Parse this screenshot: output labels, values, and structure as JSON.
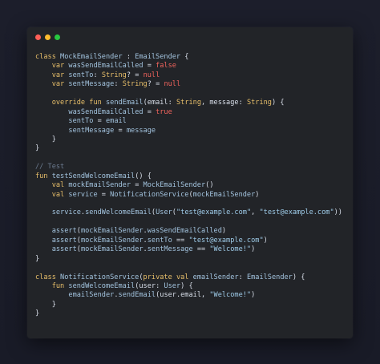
{
  "window": {
    "controls": [
      {
        "name": "close",
        "color": "#ff5f57"
      },
      {
        "name": "minimize",
        "color": "#febc2e"
      },
      {
        "name": "zoom",
        "color": "#28c840"
      }
    ]
  },
  "code_lines": [
    [
      {
        "text": "class ",
        "cls": "k"
      },
      {
        "text": "MockEmailSender",
        "cls": "c"
      },
      {
        "text": " : ",
        "cls": "p"
      },
      {
        "text": "EmailSender",
        "cls": "c"
      },
      {
        "text": " {",
        "cls": "p"
      }
    ],
    [
      {
        "text": "    ",
        "cls": "p"
      },
      {
        "text": "var ",
        "cls": "k"
      },
      {
        "text": "wasSendEmailCalled",
        "cls": "c"
      },
      {
        "text": " = ",
        "cls": "p"
      },
      {
        "text": "false",
        "cls": "b"
      }
    ],
    [
      {
        "text": "    ",
        "cls": "p"
      },
      {
        "text": "var ",
        "cls": "k"
      },
      {
        "text": "sentTo",
        "cls": "c"
      },
      {
        "text": ": ",
        "cls": "p"
      },
      {
        "text": "String",
        "cls": "k"
      },
      {
        "text": "? = ",
        "cls": "p"
      },
      {
        "text": "null",
        "cls": "b"
      }
    ],
    [
      {
        "text": "    ",
        "cls": "p"
      },
      {
        "text": "var ",
        "cls": "k"
      },
      {
        "text": "sentMessage",
        "cls": "c"
      },
      {
        "text": ": ",
        "cls": "p"
      },
      {
        "text": "String",
        "cls": "k"
      },
      {
        "text": "? = ",
        "cls": "p"
      },
      {
        "text": "null",
        "cls": "b"
      }
    ],
    [],
    [
      {
        "text": "    ",
        "cls": "p"
      },
      {
        "text": "override ",
        "cls": "k"
      },
      {
        "text": "fun ",
        "cls": "k"
      },
      {
        "text": "sendEmail",
        "cls": "c"
      },
      {
        "text": "(email: ",
        "cls": "p"
      },
      {
        "text": "String",
        "cls": "k"
      },
      {
        "text": ", message: ",
        "cls": "p"
      },
      {
        "text": "String",
        "cls": "k"
      },
      {
        "text": ") {",
        "cls": "p"
      }
    ],
    [
      {
        "text": "        ",
        "cls": "p"
      },
      {
        "text": "wasSendEmailCalled",
        "cls": "c"
      },
      {
        "text": " = ",
        "cls": "p"
      },
      {
        "text": "true",
        "cls": "b"
      }
    ],
    [
      {
        "text": "        ",
        "cls": "p"
      },
      {
        "text": "sentTo",
        "cls": "c"
      },
      {
        "text": " = ",
        "cls": "p"
      },
      {
        "text": "email",
        "cls": "c"
      }
    ],
    [
      {
        "text": "        ",
        "cls": "p"
      },
      {
        "text": "sentMessage",
        "cls": "c"
      },
      {
        "text": " = ",
        "cls": "p"
      },
      {
        "text": "message",
        "cls": "c"
      }
    ],
    [
      {
        "text": "    }",
        "cls": "p"
      }
    ],
    [
      {
        "text": "}",
        "cls": "p"
      }
    ],
    [],
    [
      {
        "text": "// Test",
        "cls": "cm"
      }
    ],
    [
      {
        "text": "fun ",
        "cls": "k"
      },
      {
        "text": "testSendWelcomeEmail",
        "cls": "c"
      },
      {
        "text": "() {",
        "cls": "p"
      }
    ],
    [
      {
        "text": "    ",
        "cls": "p"
      },
      {
        "text": "val ",
        "cls": "k"
      },
      {
        "text": "mockEmailSender",
        "cls": "c"
      },
      {
        "text": " = ",
        "cls": "p"
      },
      {
        "text": "MockEmailSender",
        "cls": "c"
      },
      {
        "text": "()",
        "cls": "p"
      }
    ],
    [
      {
        "text": "    ",
        "cls": "p"
      },
      {
        "text": "val ",
        "cls": "k"
      },
      {
        "text": "service",
        "cls": "c"
      },
      {
        "text": " = ",
        "cls": "p"
      },
      {
        "text": "NotificationService",
        "cls": "c"
      },
      {
        "text": "(",
        "cls": "p"
      },
      {
        "text": "mockEmailSender",
        "cls": "c"
      },
      {
        "text": ")",
        "cls": "p"
      }
    ],
    [],
    [
      {
        "text": "    ",
        "cls": "p"
      },
      {
        "text": "service",
        "cls": "c"
      },
      {
        "text": ".",
        "cls": "p"
      },
      {
        "text": "sendWelcomeEmail",
        "cls": "c"
      },
      {
        "text": "(",
        "cls": "p"
      },
      {
        "text": "User",
        "cls": "c"
      },
      {
        "text": "(",
        "cls": "p"
      },
      {
        "text": "\"test@example.com\"",
        "cls": "s"
      },
      {
        "text": ", ",
        "cls": "p"
      },
      {
        "text": "\"test@example.com\"",
        "cls": "s"
      },
      {
        "text": "))",
        "cls": "p"
      }
    ],
    [],
    [
      {
        "text": "    ",
        "cls": "p"
      },
      {
        "text": "assert",
        "cls": "c"
      },
      {
        "text": "(",
        "cls": "p"
      },
      {
        "text": "mockEmailSender",
        "cls": "c"
      },
      {
        "text": ".",
        "cls": "p"
      },
      {
        "text": "wasSendEmailCalled",
        "cls": "c"
      },
      {
        "text": ")",
        "cls": "p"
      }
    ],
    [
      {
        "text": "    ",
        "cls": "p"
      },
      {
        "text": "assert",
        "cls": "c"
      },
      {
        "text": "(",
        "cls": "p"
      },
      {
        "text": "mockEmailSender",
        "cls": "c"
      },
      {
        "text": ".",
        "cls": "p"
      },
      {
        "text": "sentTo",
        "cls": "c"
      },
      {
        "text": " == ",
        "cls": "p"
      },
      {
        "text": "\"test@example.com\"",
        "cls": "s"
      },
      {
        "text": ")",
        "cls": "p"
      }
    ],
    [
      {
        "text": "    ",
        "cls": "p"
      },
      {
        "text": "assert",
        "cls": "c"
      },
      {
        "text": "(",
        "cls": "p"
      },
      {
        "text": "mockEmailSender",
        "cls": "c"
      },
      {
        "text": ".",
        "cls": "p"
      },
      {
        "text": "sentMessage",
        "cls": "c"
      },
      {
        "text": " == ",
        "cls": "p"
      },
      {
        "text": "\"Welcome!\"",
        "cls": "s"
      },
      {
        "text": ")",
        "cls": "p"
      }
    ],
    [
      {
        "text": "}",
        "cls": "p"
      }
    ],
    [],
    [
      {
        "text": "class ",
        "cls": "k"
      },
      {
        "text": "NotificationService",
        "cls": "c"
      },
      {
        "text": "(",
        "cls": "p"
      },
      {
        "text": "private ",
        "cls": "k"
      },
      {
        "text": "val ",
        "cls": "k"
      },
      {
        "text": "emailSender",
        "cls": "c"
      },
      {
        "text": ": ",
        "cls": "p"
      },
      {
        "text": "EmailSender",
        "cls": "c"
      },
      {
        "text": ") {",
        "cls": "p"
      }
    ],
    [
      {
        "text": "    ",
        "cls": "p"
      },
      {
        "text": "fun ",
        "cls": "k"
      },
      {
        "text": "sendWelcomeEmail",
        "cls": "c"
      },
      {
        "text": "(user: ",
        "cls": "p"
      },
      {
        "text": "User",
        "cls": "c"
      },
      {
        "text": ") {",
        "cls": "p"
      }
    ],
    [
      {
        "text": "        ",
        "cls": "p"
      },
      {
        "text": "emailSender",
        "cls": "c"
      },
      {
        "text": ".",
        "cls": "p"
      },
      {
        "text": "sendEmail",
        "cls": "c"
      },
      {
        "text": "(user.email, ",
        "cls": "p"
      },
      {
        "text": "\"Welcome!\"",
        "cls": "s"
      },
      {
        "text": ")",
        "cls": "p"
      }
    ],
    [
      {
        "text": "    }",
        "cls": "p"
      }
    ],
    [
      {
        "text": "}",
        "cls": "p"
      }
    ]
  ]
}
